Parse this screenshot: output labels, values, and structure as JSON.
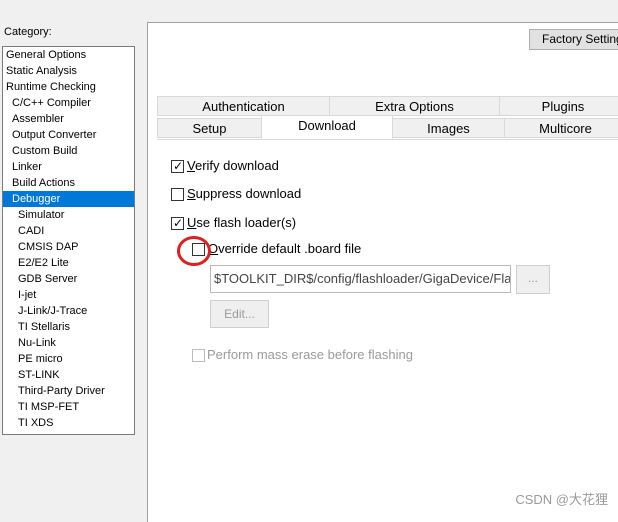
{
  "sidebar": {
    "category_label": "Category:",
    "items": [
      {
        "label": "General Options",
        "level": 0
      },
      {
        "label": "Static Analysis",
        "level": 0
      },
      {
        "label": "Runtime Checking",
        "level": 0
      },
      {
        "label": "C/C++ Compiler",
        "level": 1
      },
      {
        "label": "Assembler",
        "level": 1
      },
      {
        "label": "Output Converter",
        "level": 1
      },
      {
        "label": "Custom Build",
        "level": 1
      },
      {
        "label": "Linker",
        "level": 1
      },
      {
        "label": "Build Actions",
        "level": 1
      },
      {
        "label": "Debugger",
        "level": 1,
        "selected": true
      },
      {
        "label": "Simulator",
        "level": 2
      },
      {
        "label": "CADI",
        "level": 2
      },
      {
        "label": "CMSIS DAP",
        "level": 2
      },
      {
        "label": "E2/E2 Lite",
        "level": 2
      },
      {
        "label": "GDB Server",
        "level": 2
      },
      {
        "label": "I-jet",
        "level": 2
      },
      {
        "label": "J-Link/J-Trace",
        "level": 2
      },
      {
        "label": "TI Stellaris",
        "level": 2
      },
      {
        "label": "Nu-Link",
        "level": 2
      },
      {
        "label": "PE micro",
        "level": 2
      },
      {
        "label": "ST-LINK",
        "level": 2
      },
      {
        "label": "Third-Party Driver",
        "level": 2
      },
      {
        "label": "TI MSP-FET",
        "level": 2
      },
      {
        "label": "TI XDS",
        "level": 2
      }
    ]
  },
  "toolbar": {
    "factory_label": "Factory Settings"
  },
  "tabs": {
    "row1": [
      "Authentication",
      "Extra Options",
      "Plugins"
    ],
    "row2": [
      "Setup",
      "Download",
      "Images",
      "Multicore"
    ],
    "active": "Download"
  },
  "options": {
    "verify": {
      "label": "Verify download",
      "checked": true
    },
    "suppress": {
      "label": "Suppress download",
      "checked": false
    },
    "flash_loader": {
      "label": "Use flash loader(s)",
      "checked": true
    },
    "override": {
      "label": "Override default .board file",
      "checked": false
    },
    "mass_erase": {
      "label": "Perform mass erase before flashing",
      "checked": false,
      "disabled": true
    }
  },
  "board_file": {
    "value": "$TOOLKIT_DIR$/config/flashloader/GigaDevice/Fla"
  },
  "buttons": {
    "browse_label": "...",
    "edit_label": "Edit..."
  },
  "annotation": {
    "color": "#e02020"
  },
  "watermark": "CSDN @大花狸",
  "colors": {
    "selection": "#0078d7",
    "panel": "#ffffff",
    "window": "#f0f0f0"
  }
}
